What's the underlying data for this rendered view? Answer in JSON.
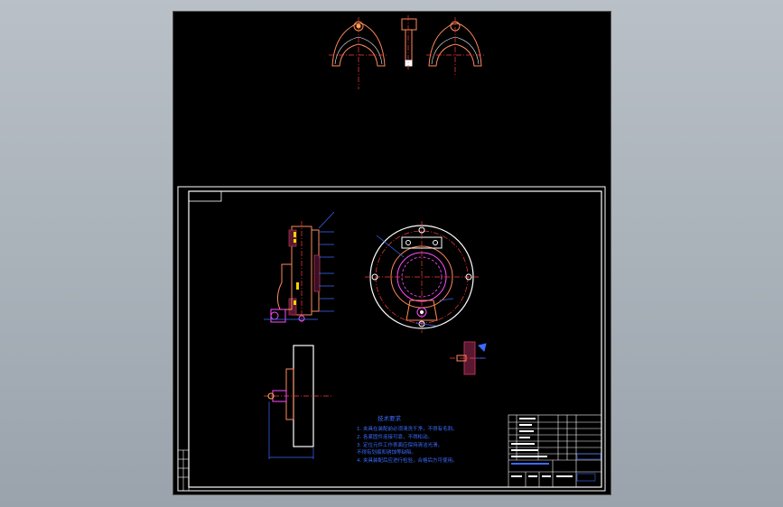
{
  "drawing": {
    "colors": {
      "background": "#000000",
      "border": "#ffffff",
      "part": "#ff8a5b",
      "center": "#ff3b3b",
      "dimension": "#3b6bff",
      "fixture": "#ff4dff",
      "hatch": "#b0305a"
    },
    "tech_notes": {
      "title": "技术要求",
      "lines": [
        "1. 夹具在装配前必须清洗干净，不得有毛刺。",
        "2. 各紧固件连接可靠，不得松动。",
        "3. 定位元件工作表面应保持清洁光滑，",
        "   不得有划痕和锈蚀等缺陷。",
        "4. 夹具装配后应进行检验，合格后方可使用。"
      ]
    },
    "title_block": {
      "rows": 7
    }
  }
}
